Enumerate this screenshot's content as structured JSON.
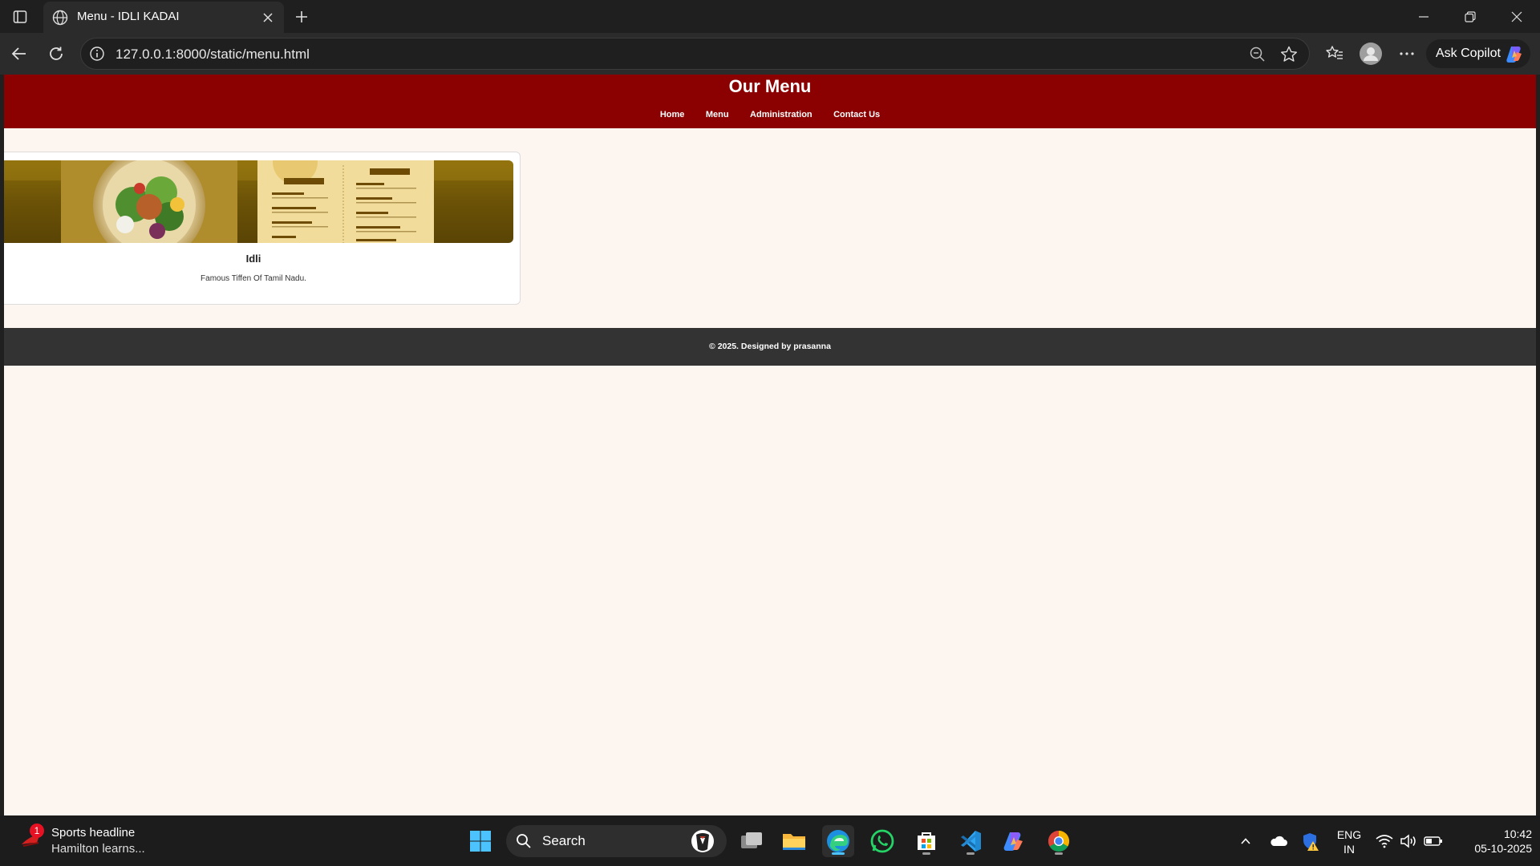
{
  "browser": {
    "tab_title": "Menu - IDLI KADAI",
    "url": "127.0.0.1:8000/static/menu.html",
    "copilot_label": "Ask Copilot"
  },
  "page": {
    "header": {
      "title": "Our Menu",
      "nav": [
        "Home",
        "Menu",
        "Administration",
        "Contact Us"
      ]
    },
    "menu_items": [
      {
        "name": "Idli",
        "description": "Famous Tiffen Of Tamil Nadu."
      }
    ],
    "footer": "© 2025. Designed by prasanna",
    "colors": {
      "header_bg": "#8b0000",
      "page_bg": "#fdf5f0",
      "footer_bg": "#333333"
    }
  },
  "taskbar": {
    "news_badge": "1",
    "news_title": "Sports headline",
    "news_subtitle": "Hamilton learns...",
    "search_label": "Search",
    "lang_line1": "ENG",
    "lang_line2": "IN",
    "time": "10:42",
    "date": "05-10-2025"
  }
}
